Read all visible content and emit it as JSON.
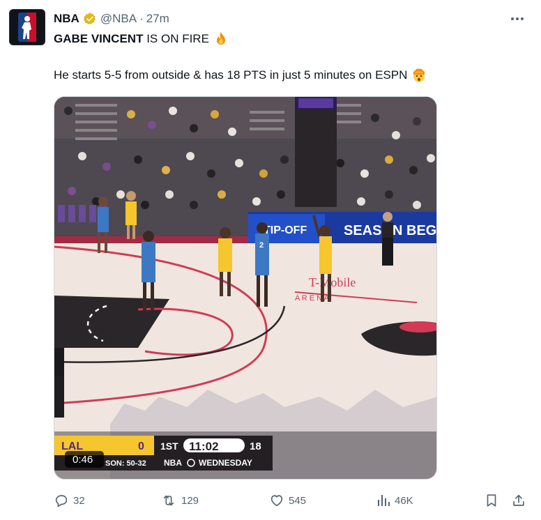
{
  "tweet": {
    "author_name": "NBA",
    "handle": "@NBA",
    "separator": "·",
    "time": "27m",
    "headline_bold": "GABE VINCENT",
    "headline_rest": " IS ON FIRE",
    "body": "He starts 5-5 from outside & has 18 PTS in just 5 minutes on ESPN",
    "icons": {
      "avatar": "nba-logo-icon",
      "verified": "verified-badge-icon",
      "more": "more-options-icon",
      "fire": "fire-emoji",
      "mind_blown": "exploding-head-emoji"
    }
  },
  "media": {
    "video_timer": "0:46",
    "scoreboard": {
      "team": "LAL",
      "team_score": "0",
      "quarter": "1ST",
      "clock": "11:02",
      "shot_clock": "18",
      "season_text": "SON: 50-32",
      "network": "NBA",
      "day": "WEDNESDAY"
    },
    "arena_text": "T-Mobile",
    "arena_sub": "A R E N A",
    "board_left": "TIP-OFF",
    "board_right": "SEASON BEGINS",
    "jersey_2": "2"
  },
  "actions": {
    "replies": "32",
    "reposts": "129",
    "likes": "545",
    "views": "46K"
  },
  "colors": {
    "text_primary": "#0f1419",
    "text_secondary": "#536471",
    "lakers_gold": "#f5c62d",
    "lakers_purple": "#552583",
    "mavs_blue": "#3d78c4",
    "court_red": "#d23a55"
  }
}
